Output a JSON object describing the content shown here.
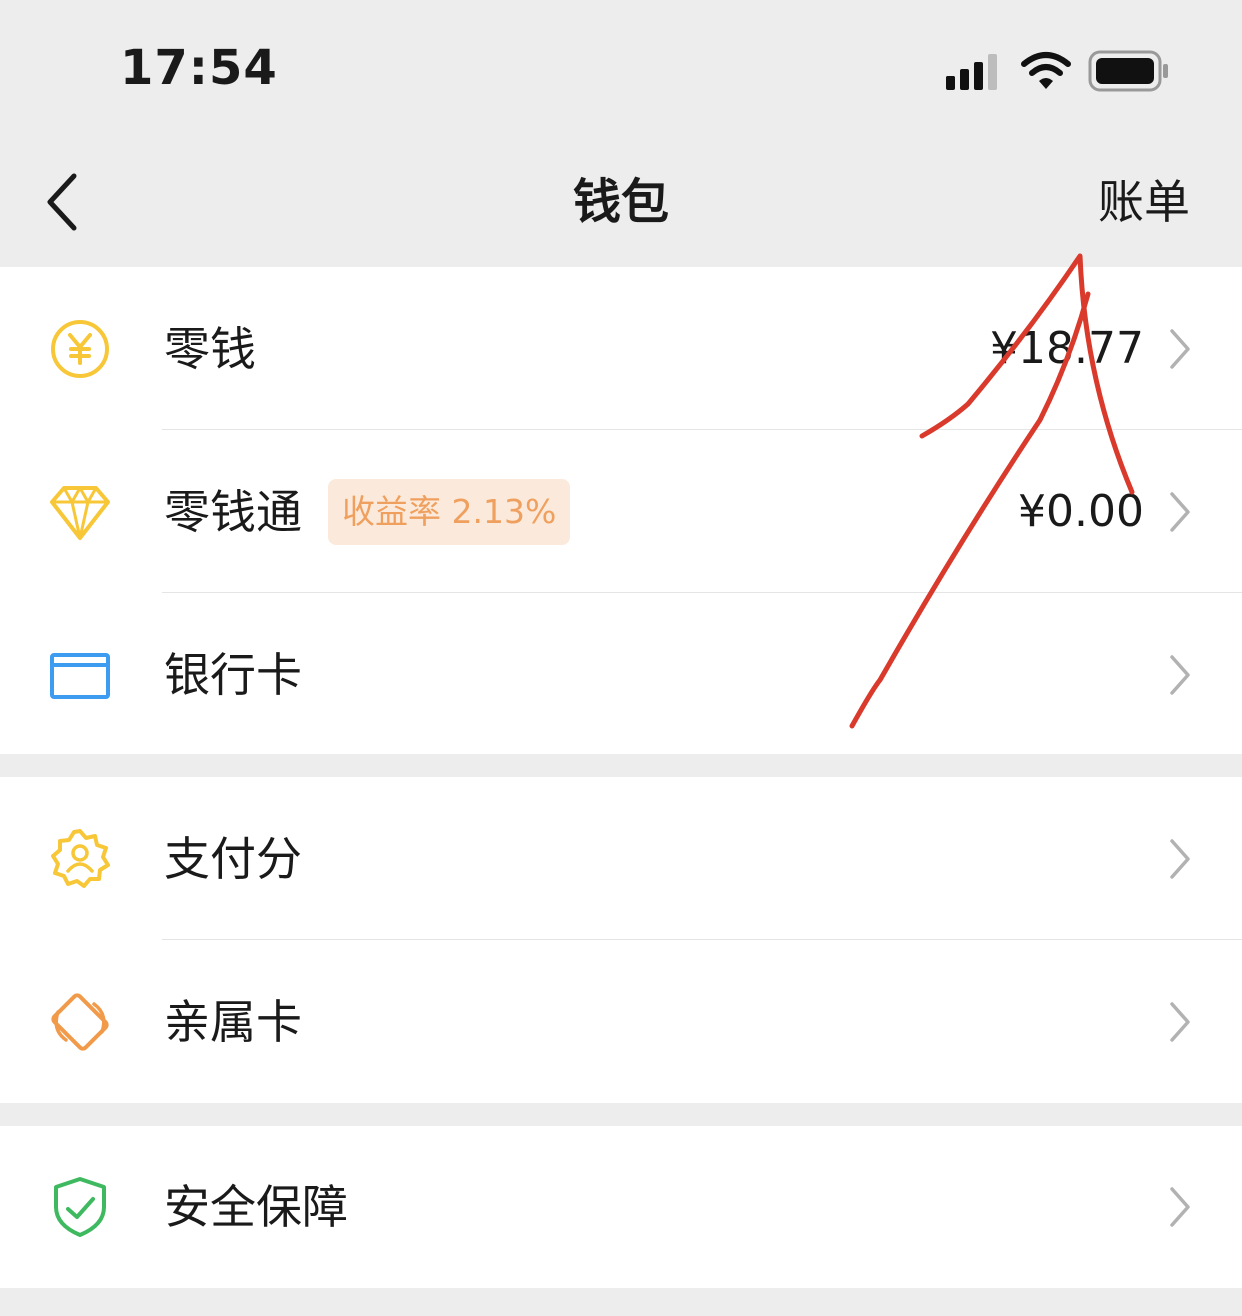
{
  "status_bar": {
    "time": "17:54",
    "icons": [
      "cellular-signal-icon",
      "wifi-icon",
      "battery-icon"
    ]
  },
  "nav": {
    "back_icon": "chevron-left-icon",
    "title": "钱包",
    "right_action": "账单"
  },
  "group1": [
    {
      "icon": "yuan-coin-icon",
      "label": "零钱",
      "value": "¥18.77"
    },
    {
      "icon": "diamond-icon",
      "label": "零钱通",
      "badge": "收益率 2.13%",
      "value": "¥0.00"
    },
    {
      "icon": "bank-card-icon",
      "label": "银行卡",
      "value": ""
    }
  ],
  "group2": [
    {
      "icon": "pay-score-icon",
      "label": "支付分"
    },
    {
      "icon": "family-card-icon",
      "label": "亲属卡"
    }
  ],
  "group3": [
    {
      "icon": "shield-check-icon",
      "label": "安全保障"
    }
  ],
  "colors": {
    "background": "#ededed",
    "yellow_icon": "#f7c737",
    "orange_icon": "#f19a4a",
    "blue_icon": "#3d9cf0",
    "green_icon": "#3fb95f",
    "badge_bg": "#fbeadc",
    "badge_text": "#f0a05e",
    "annotation_red": "#d93a2b"
  }
}
